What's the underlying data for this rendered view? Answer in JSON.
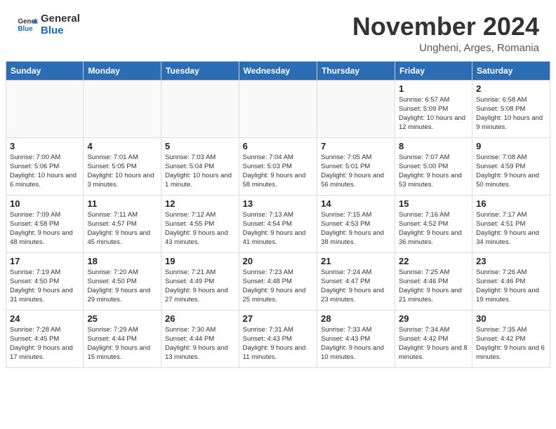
{
  "header": {
    "logo_general": "General",
    "logo_blue": "Blue",
    "month_title": "November 2024",
    "subtitle": "Ungheni, Arges, Romania"
  },
  "days_of_week": [
    "Sunday",
    "Monday",
    "Tuesday",
    "Wednesday",
    "Thursday",
    "Friday",
    "Saturday"
  ],
  "weeks": [
    [
      {
        "day": "",
        "info": ""
      },
      {
        "day": "",
        "info": ""
      },
      {
        "day": "",
        "info": ""
      },
      {
        "day": "",
        "info": ""
      },
      {
        "day": "",
        "info": ""
      },
      {
        "day": "1",
        "info": "Sunrise: 6:57 AM\nSunset: 5:09 PM\nDaylight: 10 hours and 12 minutes."
      },
      {
        "day": "2",
        "info": "Sunrise: 6:58 AM\nSunset: 5:08 PM\nDaylight: 10 hours and 9 minutes."
      }
    ],
    [
      {
        "day": "3",
        "info": "Sunrise: 7:00 AM\nSunset: 5:06 PM\nDaylight: 10 hours and 6 minutes."
      },
      {
        "day": "4",
        "info": "Sunrise: 7:01 AM\nSunset: 5:05 PM\nDaylight: 10 hours and 3 minutes."
      },
      {
        "day": "5",
        "info": "Sunrise: 7:03 AM\nSunset: 5:04 PM\nDaylight: 10 hours and 1 minute."
      },
      {
        "day": "6",
        "info": "Sunrise: 7:04 AM\nSunset: 5:03 PM\nDaylight: 9 hours and 58 minutes."
      },
      {
        "day": "7",
        "info": "Sunrise: 7:05 AM\nSunset: 5:01 PM\nDaylight: 9 hours and 56 minutes."
      },
      {
        "day": "8",
        "info": "Sunrise: 7:07 AM\nSunset: 5:00 PM\nDaylight: 9 hours and 53 minutes."
      },
      {
        "day": "9",
        "info": "Sunrise: 7:08 AM\nSunset: 4:59 PM\nDaylight: 9 hours and 50 minutes."
      }
    ],
    [
      {
        "day": "10",
        "info": "Sunrise: 7:09 AM\nSunset: 4:58 PM\nDaylight: 9 hours and 48 minutes."
      },
      {
        "day": "11",
        "info": "Sunrise: 7:11 AM\nSunset: 4:57 PM\nDaylight: 9 hours and 45 minutes."
      },
      {
        "day": "12",
        "info": "Sunrise: 7:12 AM\nSunset: 4:55 PM\nDaylight: 9 hours and 43 minutes."
      },
      {
        "day": "13",
        "info": "Sunrise: 7:13 AM\nSunset: 4:54 PM\nDaylight: 9 hours and 41 minutes."
      },
      {
        "day": "14",
        "info": "Sunrise: 7:15 AM\nSunset: 4:53 PM\nDaylight: 9 hours and 38 minutes."
      },
      {
        "day": "15",
        "info": "Sunrise: 7:16 AM\nSunset: 4:52 PM\nDaylight: 9 hours and 36 minutes."
      },
      {
        "day": "16",
        "info": "Sunrise: 7:17 AM\nSunset: 4:51 PM\nDaylight: 9 hours and 34 minutes."
      }
    ],
    [
      {
        "day": "17",
        "info": "Sunrise: 7:19 AM\nSunset: 4:50 PM\nDaylight: 9 hours and 31 minutes."
      },
      {
        "day": "18",
        "info": "Sunrise: 7:20 AM\nSunset: 4:50 PM\nDaylight: 9 hours and 29 minutes."
      },
      {
        "day": "19",
        "info": "Sunrise: 7:21 AM\nSunset: 4:49 PM\nDaylight: 9 hours and 27 minutes."
      },
      {
        "day": "20",
        "info": "Sunrise: 7:23 AM\nSunset: 4:48 PM\nDaylight: 9 hours and 25 minutes."
      },
      {
        "day": "21",
        "info": "Sunrise: 7:24 AM\nSunset: 4:47 PM\nDaylight: 9 hours and 23 minutes."
      },
      {
        "day": "22",
        "info": "Sunrise: 7:25 AM\nSunset: 4:46 PM\nDaylight: 9 hours and 21 minutes."
      },
      {
        "day": "23",
        "info": "Sunrise: 7:26 AM\nSunset: 4:46 PM\nDaylight: 9 hours and 19 minutes."
      }
    ],
    [
      {
        "day": "24",
        "info": "Sunrise: 7:28 AM\nSunset: 4:45 PM\nDaylight: 9 hours and 17 minutes."
      },
      {
        "day": "25",
        "info": "Sunrise: 7:29 AM\nSunset: 4:44 PM\nDaylight: 9 hours and 15 minutes."
      },
      {
        "day": "26",
        "info": "Sunrise: 7:30 AM\nSunset: 4:44 PM\nDaylight: 9 hours and 13 minutes."
      },
      {
        "day": "27",
        "info": "Sunrise: 7:31 AM\nSunset: 4:43 PM\nDaylight: 9 hours and 11 minutes."
      },
      {
        "day": "28",
        "info": "Sunrise: 7:33 AM\nSunset: 4:43 PM\nDaylight: 9 hours and 10 minutes."
      },
      {
        "day": "29",
        "info": "Sunrise: 7:34 AM\nSunset: 4:42 PM\nDaylight: 9 hours and 8 minutes."
      },
      {
        "day": "30",
        "info": "Sunrise: 7:35 AM\nSunset: 4:42 PM\nDaylight: 9 hours and 6 minutes."
      }
    ]
  ]
}
